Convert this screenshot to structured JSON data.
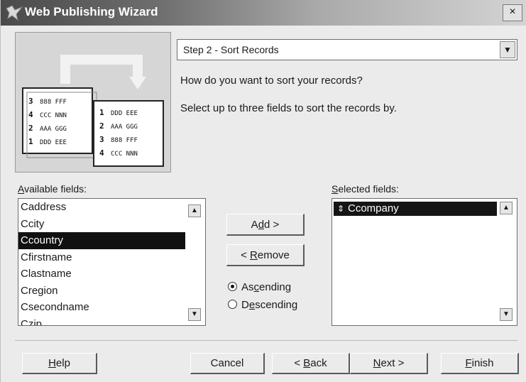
{
  "window": {
    "title": "Web Publishing Wizard",
    "close_label": "×"
  },
  "step": {
    "selected": "Step 2 - Sort Records",
    "question": "How do you want to sort your records?",
    "instruction": "Select up to three fields to sort the records by."
  },
  "illustration": {
    "left_card": [
      {
        "num": "3",
        "text": "888 FFF"
      },
      {
        "num": "4",
        "text": "CCC NNN"
      },
      {
        "num": "2",
        "text": "AAA GGG"
      },
      {
        "num": "1",
        "text": "DDD EEE"
      }
    ],
    "right_card": [
      {
        "num": "1",
        "text": "DDD EEE"
      },
      {
        "num": "2",
        "text": "AAA GGG"
      },
      {
        "num": "3",
        "text": "888 FFF"
      },
      {
        "num": "4",
        "text": "CCC NNN"
      }
    ]
  },
  "available": {
    "label_prefix": "A",
    "label_rest": "vailable fields:",
    "items": [
      "Caddress",
      "Ccity",
      "Ccountry",
      "Cfirstname",
      "Clastname",
      "Cregion",
      "Csecondname",
      "Czip"
    ],
    "selected_index": 2
  },
  "selected": {
    "label_prefix": "S",
    "label_rest": "elected fields:",
    "items": [
      "Ccompany"
    ]
  },
  "actions": {
    "add_pre": "A",
    "add_ul": "d",
    "add_post": "d >",
    "remove_pre": "< ",
    "remove_ul": "R",
    "remove_post": "emove"
  },
  "sort_order": {
    "asc_pre": "As",
    "asc_ul": "c",
    "asc_post": "ending",
    "desc_pre": "D",
    "desc_ul": "e",
    "desc_post": "scending",
    "value": "ascending"
  },
  "footer": {
    "help_ul": "H",
    "help_post": "elp",
    "cancel": "Cancel",
    "back_pre": "< ",
    "back_ul": "B",
    "back_post": "ack",
    "next_ul": "N",
    "next_post": "ext >",
    "finish_ul": "F",
    "finish_post": "inish"
  }
}
